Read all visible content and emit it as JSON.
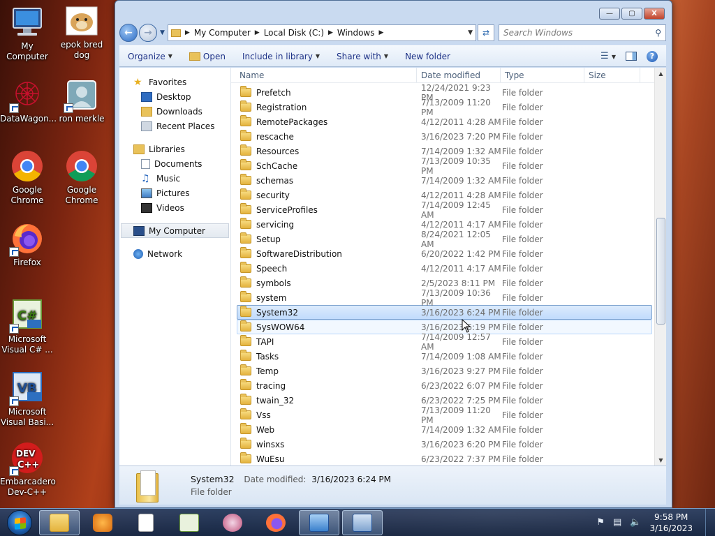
{
  "desktop": {
    "icons": [
      {
        "label": "My Computer",
        "icon": "computer-icon"
      },
      {
        "label": "epok bred dog",
        "icon": "image-file-icon"
      },
      {
        "label": "DataWagon...",
        "icon": "app-shortcut-icon"
      },
      {
        "label": "ron merkle",
        "icon": "user-shortcut-icon"
      },
      {
        "label": "Google Chrome",
        "icon": "chrome-icon"
      },
      {
        "label": "Google Chrome",
        "icon": "chrome-icon"
      },
      {
        "label": "Firefox",
        "icon": "firefox-icon"
      },
      {
        "label": "Microsoft Visual C# ...",
        "icon": "visual-csharp-icon"
      },
      {
        "label": "Microsoft Visual Basi...",
        "icon": "visual-basic-icon"
      },
      {
        "label": "Embarcadero Dev-C++",
        "icon": "devcpp-icon"
      }
    ]
  },
  "window": {
    "controls": {
      "minimize": "—",
      "maximize": "▢",
      "close": "X"
    },
    "address": {
      "crumbs": [
        "My Computer",
        "Local Disk (C:)",
        "Windows"
      ]
    },
    "search": {
      "placeholder": "Search Windows"
    },
    "toolbar": {
      "organize": "Organize",
      "open": "Open",
      "include": "Include in library",
      "share": "Share with",
      "new_folder": "New folder"
    },
    "nav": {
      "favorites": "Favorites",
      "desktop": "Desktop",
      "downloads": "Downloads",
      "recent": "Recent Places",
      "libraries": "Libraries",
      "documents": "Documents",
      "music": "Music",
      "pictures": "Pictures",
      "videos": "Videos",
      "computer": "My Computer",
      "network": "Network"
    },
    "columns": {
      "name": "Name",
      "date": "Date modified",
      "type": "Type",
      "size": "Size"
    },
    "files": [
      {
        "name": "Prefetch",
        "date": "12/24/2021 9:23 PM",
        "type": "File folder"
      },
      {
        "name": "Registration",
        "date": "7/13/2009 11:20 PM",
        "type": "File folder"
      },
      {
        "name": "RemotePackages",
        "date": "4/12/2011 4:28 AM",
        "type": "File folder"
      },
      {
        "name": "rescache",
        "date": "3/16/2023 7:20 PM",
        "type": "File folder"
      },
      {
        "name": "Resources",
        "date": "7/14/2009 1:32 AM",
        "type": "File folder"
      },
      {
        "name": "SchCache",
        "date": "7/13/2009 10:35 PM",
        "type": "File folder"
      },
      {
        "name": "schemas",
        "date": "7/14/2009 1:32 AM",
        "type": "File folder"
      },
      {
        "name": "security",
        "date": "4/12/2011 4:28 AM",
        "type": "File folder"
      },
      {
        "name": "ServiceProfiles",
        "date": "7/14/2009 12:45 AM",
        "type": "File folder"
      },
      {
        "name": "servicing",
        "date": "4/12/2011 4:17 AM",
        "type": "File folder"
      },
      {
        "name": "Setup",
        "date": "8/24/2021 12:05 AM",
        "type": "File folder"
      },
      {
        "name": "SoftwareDistribution",
        "date": "6/20/2022 1:42 PM",
        "type": "File folder"
      },
      {
        "name": "Speech",
        "date": "4/12/2011 4:17 AM",
        "type": "File folder"
      },
      {
        "name": "symbols",
        "date": "2/5/2023 8:11 PM",
        "type": "File folder"
      },
      {
        "name": "system",
        "date": "7/13/2009 10:36 PM",
        "type": "File folder"
      },
      {
        "name": "System32",
        "date": "3/16/2023 6:24 PM",
        "type": "File folder",
        "state": "selected"
      },
      {
        "name": "SysWOW64",
        "date": "3/16/2023 6:19 PM",
        "type": "File folder",
        "state": "hover"
      },
      {
        "name": "TAPI",
        "date": "7/14/2009 12:57 AM",
        "type": "File folder"
      },
      {
        "name": "Tasks",
        "date": "7/14/2009 1:08 AM",
        "type": "File folder"
      },
      {
        "name": "Temp",
        "date": "3/16/2023 9:27 PM",
        "type": "File folder"
      },
      {
        "name": "tracing",
        "date": "6/23/2022 6:07 PM",
        "type": "File folder"
      },
      {
        "name": "twain_32",
        "date": "6/23/2022 7:25 PM",
        "type": "File folder"
      },
      {
        "name": "Vss",
        "date": "7/13/2009 11:20 PM",
        "type": "File folder"
      },
      {
        "name": "Web",
        "date": "7/14/2009 1:32 AM",
        "type": "File folder"
      },
      {
        "name": "winsxs",
        "date": "3/16/2023 6:20 PM",
        "type": "File folder"
      },
      {
        "name": "WuEsu",
        "date": "6/23/2022 7:37 PM",
        "type": "File folder"
      }
    ],
    "details": {
      "name": "System32",
      "date_label": "Date modified:",
      "date_value": "3/16/2023 6:24 PM",
      "type": "File folder"
    }
  },
  "taskbar": {
    "clock_time": "9:58 PM",
    "clock_date": "3/16/2023"
  },
  "colors": {
    "selection": "#c1dbfc",
    "accent": "#1e3287",
    "taskbar": "#1c3a62"
  }
}
